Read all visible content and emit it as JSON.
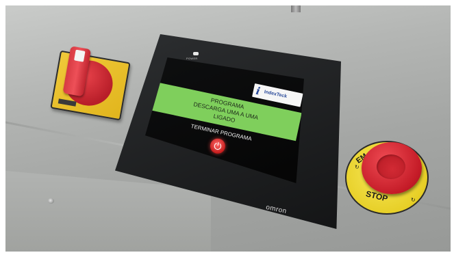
{
  "panel": {
    "hmi": {
      "power_label": "POWER",
      "brand": "omron",
      "screen": {
        "logo_mark": "i",
        "logo_text": "IndexTeck",
        "banner_lines": [
          "PROGRAMA",
          "DESCARGA UMA A UMA",
          "LIGADO"
        ],
        "terminate_label": "TERMINAR PROGRAMA",
        "power_button_glyph": "⏻"
      }
    },
    "emergency_stop": {
      "label_top": "EM",
      "label_bottom": "STOP"
    },
    "colors": {
      "banner": "#7fcf5c",
      "emergency_button": "#c41b27",
      "emergency_collar": "#e7cf27",
      "switch_knob": "#b81e29",
      "switch_plate": "#e1b51d"
    }
  }
}
